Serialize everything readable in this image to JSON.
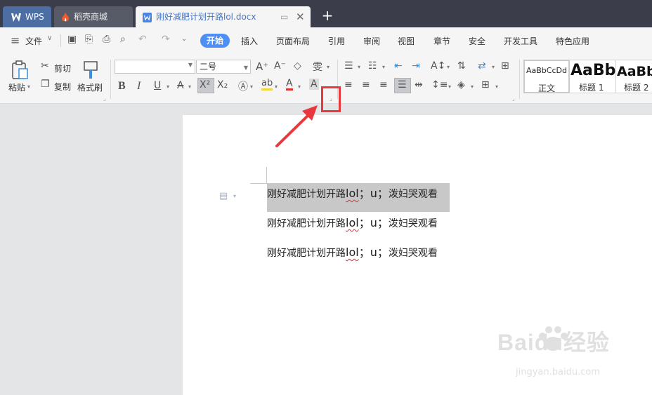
{
  "tabs": {
    "wps": "WPS",
    "store": "稻壳商城",
    "document": "刚好减肥计划开路lol.docx"
  },
  "menu": {
    "file": "文件",
    "items": [
      "开始",
      "插入",
      "页面布局",
      "引用",
      "审阅",
      "视图",
      "章节",
      "安全",
      "开发工具",
      "特色应用"
    ]
  },
  "ribbon": {
    "paste": "粘贴",
    "cut": "剪切",
    "copy": "复制",
    "format_painter": "格式刷",
    "font_name": "",
    "font_size": "二号",
    "styles": [
      {
        "preview": "AaBbCcDd",
        "label": "正文"
      },
      {
        "preview": "AaBb",
        "label": "标题 1"
      },
      {
        "preview": "AaBb",
        "label": "标题 2"
      }
    ]
  },
  "document": {
    "lines": [
      {
        "prefix": "刚好减肥计划开路",
        "word": "lol",
        "mid": "；u；",
        "suffix": "泼妇哭观看"
      },
      {
        "prefix": "刚好减肥计划开路",
        "word": "lol",
        "mid": "；u；",
        "suffix": "泼妇哭观看"
      },
      {
        "prefix": "刚好减肥计划开路",
        "word": "lol",
        "mid": "；u；",
        "suffix": "泼妇哭观看"
      }
    ]
  },
  "watermark": {
    "brand": "Baidu经验",
    "url": "jingyan.baidu.com"
  },
  "colors": {
    "titlebar": "#3b3e4a",
    "accent": "#4d8ff4",
    "highlight_box": "#e8383d",
    "selection": "#c8c8c8"
  }
}
